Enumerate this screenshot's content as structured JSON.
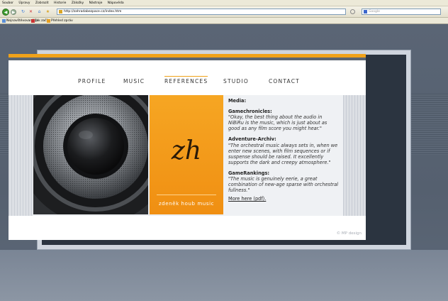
{
  "browser": {
    "menu": [
      "Soubor",
      "Úpravy",
      "Zobrazit",
      "Historie",
      "Záložky",
      "Nástroje",
      "Nápověda"
    ],
    "address": "http://zahradabezpace.cz/index.htm",
    "search_placeholder": "Google",
    "bookmarks": [
      "Nejnavštěvovanější",
      "Jak začít",
      "Přehled zpráv"
    ],
    "icons": [
      "back-icon",
      "forward-icon",
      "reload-icon",
      "stop-icon",
      "home-icon"
    ]
  },
  "site": {
    "nav": [
      "PROFILE",
      "MUSIC",
      "REFERENCES",
      "STUDIO",
      "CONTACT"
    ],
    "active_nav": "REFERENCES",
    "logo": "zh",
    "brand": "zdeněk houb music",
    "media_heading": "Media:",
    "references": [
      {
        "source": "Gamechronicles:",
        "quote": "\"Okay, the best thing about the audio in NiBiRu is the music, which is just about as good as any film score you might hear.\""
      },
      {
        "source": "Adventure-Archiv:",
        "quote": "\"The orchestral music always sets in, when we enter new scenes, with film sequences or if suspense should be raised. It excellently supports the dark and creepy atmosphere.\""
      },
      {
        "source": "GameRankings:",
        "quote": "\"The music is genuinely eerie, a great combination of new-age sparse with orchestral fullness.\""
      }
    ],
    "more_link": "More here (pdf).",
    "copyright": "© MP design",
    "colors": {
      "accent": "#f0a21a",
      "dark": "#2b3440",
      "background": "#55606f"
    }
  }
}
